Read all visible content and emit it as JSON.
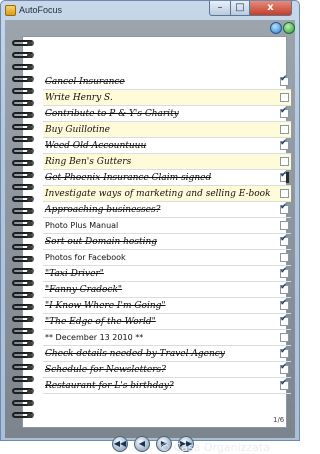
{
  "window": {
    "title": "AutoFocus",
    "controls": {
      "minimize": "–",
      "maximize": "□",
      "close": "x"
    }
  },
  "toolbar": {
    "blue_button_icon": "refresh-icon",
    "green_button_icon": "go-icon"
  },
  "items": [
    {
      "text": "Cancel Insurance",
      "done": true,
      "highlight": false,
      "checked": true
    },
    {
      "text": "Write Henry S.",
      "done": false,
      "highlight": true,
      "checked": false
    },
    {
      "text": "Contribute to P & Y's Charity",
      "done": true,
      "highlight": false,
      "checked": true
    },
    {
      "text": "Buy Guillotine",
      "done": false,
      "highlight": true,
      "checked": false
    },
    {
      "text": "Weed Old Accountuuu",
      "done": true,
      "highlight": false,
      "checked": true
    },
    {
      "text": "Ring Ben's Gutters",
      "done": false,
      "highlight": true,
      "checked": false
    },
    {
      "text": "Get Phoenix Insurance Claim signed",
      "done": true,
      "highlight": false,
      "checked": true
    },
    {
      "text": "Investigate ways of marketing and selling E-book",
      "done": false,
      "highlight": true,
      "checked": false
    },
    {
      "text": "Approaching businesses?",
      "done": true,
      "highlight": false,
      "checked": true
    },
    {
      "text": "Photo Plus Manual",
      "done": false,
      "highlight": false,
      "checked": false,
      "plain": true
    },
    {
      "text": "Sort out Domain hosting",
      "done": true,
      "highlight": false,
      "checked": true
    },
    {
      "text": "Photos for Facebook",
      "done": false,
      "highlight": false,
      "checked": false,
      "plain": true
    },
    {
      "text": "\"Taxi Driver\"",
      "done": true,
      "highlight": false,
      "checked": true
    },
    {
      "text": "\"Fanny Cradock\"",
      "done": true,
      "highlight": false,
      "checked": true
    },
    {
      "text": "\"I Know Where I'm Going\"",
      "done": true,
      "highlight": false,
      "checked": true
    },
    {
      "text": "\"The Edge of the World\"",
      "done": true,
      "highlight": false,
      "checked": true
    },
    {
      "text": "** December 13 2010 **",
      "done": false,
      "highlight": false,
      "checked": false,
      "plain": true
    },
    {
      "text": "Check details needed by Travel Agency",
      "done": true,
      "highlight": false,
      "checked": true
    },
    {
      "text": "Schedule for Newsletters?",
      "done": true,
      "highlight": false,
      "checked": true
    },
    {
      "text": "Restaurant for L's birthday?",
      "done": true,
      "highlight": false,
      "checked": true
    }
  ],
  "pager": {
    "page": "1/6"
  },
  "nav_buttons": [
    {
      "icon": "first-page-icon",
      "glyph": "◀◀"
    },
    {
      "icon": "prev-page-icon",
      "glyph": "◀"
    },
    {
      "icon": "next-page-icon",
      "glyph": "▶"
    },
    {
      "icon": "last-page-icon",
      "glyph": "▶▶"
    }
  ],
  "watermark": "© Casa Organizzata"
}
